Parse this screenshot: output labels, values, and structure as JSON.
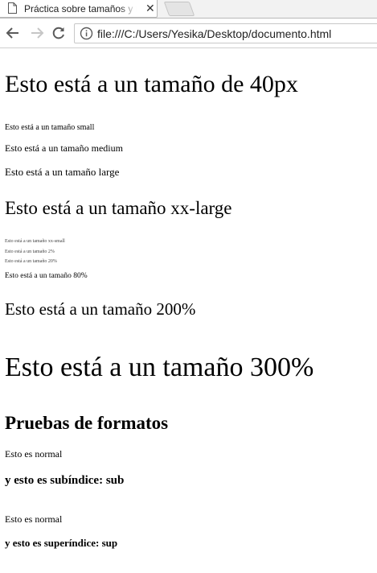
{
  "browser": {
    "tab_title": "Práctica sobre tamaños y formatos",
    "close_glyph": "✕",
    "url": "file:///C:/Users/Yesika/Desktop/documento.html",
    "icons": [
      "page-icon",
      "close-icon",
      "back-icon",
      "forward-icon",
      "reload-icon",
      "info-icon"
    ]
  },
  "page": {
    "lines": {
      "size_40px": "Esto está a un tamaño de 40px",
      "size_small": "Esto está a un tamaño small",
      "size_medium": "Esto está a un tamaño medium",
      "size_large": "Esto está a un tamaño large",
      "size_xx_large": "Esto está a un tamaño xx-large",
      "size_xx_small": "Esto está a un tamaño xx-small",
      "size_2pct": "Esto está a un tamaño 2%",
      "size_20pct": "Esto está a un tamaño 20%",
      "size_80pct": "Esto está a un tamaño 80%",
      "size_200pct": "Esto está a un tamaño 200%",
      "size_300pct": "Esto está a un tamaño 300%"
    },
    "formats": {
      "heading": "Pruebas de formatos",
      "normal_1": "Esto es normal",
      "subscript_line": "y esto es subíndice: sub",
      "normal_2": "Esto es normal",
      "superscript_line": "y esto es superíndice: sup"
    }
  }
}
